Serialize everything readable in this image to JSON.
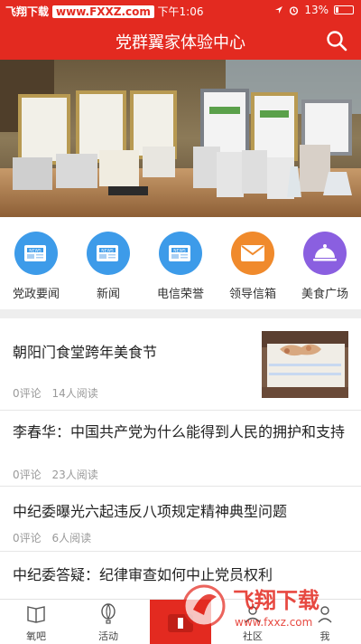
{
  "status_bar": {
    "watermark_left": "飞翔下载",
    "watermark_url": "www.FXXZ.com",
    "time": "下午1:06",
    "battery": "13%"
  },
  "nav": {
    "title": "党群翼家体验中心"
  },
  "quick_nav": [
    {
      "label": "党政要闻",
      "icon": "news-icon",
      "color": "#3d9be9"
    },
    {
      "label": "新闻",
      "icon": "news-icon",
      "color": "#3d9be9"
    },
    {
      "label": "电信荣誉",
      "icon": "news-icon",
      "color": "#3d9be9"
    },
    {
      "label": "领导信箱",
      "icon": "mail-icon",
      "color": "#f08a2c"
    },
    {
      "label": "美食广场",
      "icon": "food-cloche-icon",
      "color": "#8a5fe0"
    }
  ],
  "news": [
    {
      "title": "朝阳门食堂跨年美食节",
      "comments": "0评论",
      "reads": "14人阅读"
    },
    {
      "title": "李春华：中国共产党为什么能得到人民的拥护和支持",
      "comments": "0评论",
      "reads": "23人阅读"
    },
    {
      "title": "中纪委曝光六起违反八项规定精神典型问题",
      "comments": "0评论",
      "reads": "6人阅读"
    },
    {
      "title": "中纪委答疑：纪律审查如何中止党员权利",
      "comments": "",
      "reads": ""
    }
  ],
  "tabs": [
    {
      "label": "氧吧",
      "icon": "book-icon"
    },
    {
      "label": "活动",
      "icon": "balloon-icon"
    },
    {
      "label": "",
      "icon": "center-icon"
    },
    {
      "label": "社区",
      "icon": "community-icon"
    },
    {
      "label": "我",
      "icon": "person-icon"
    }
  ],
  "overlay_watermark": {
    "brand": "飞翔下载",
    "url": "www.fxxz.com"
  },
  "colors": {
    "brand_red": "#e32a20"
  }
}
